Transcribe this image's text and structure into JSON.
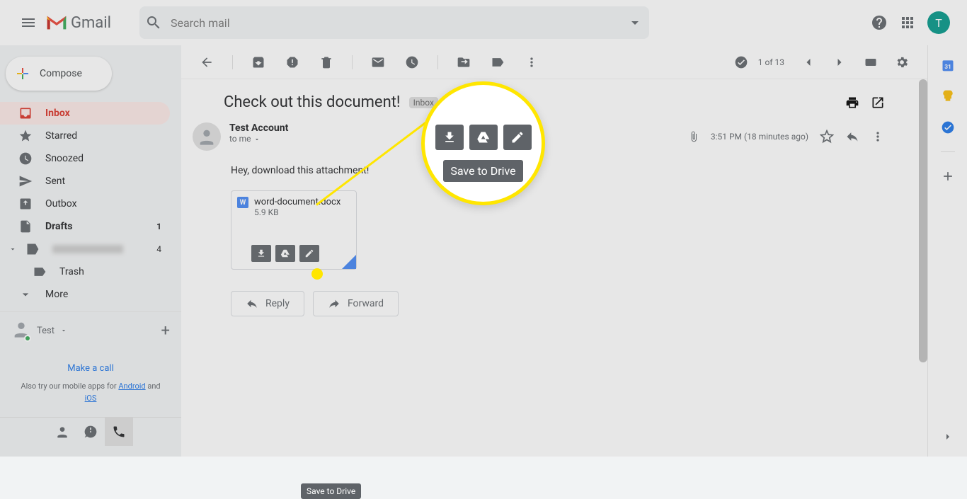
{
  "header": {
    "logo_text": "Gmail",
    "search_placeholder": "Search mail",
    "avatar_initial": "T"
  },
  "compose_label": "Compose",
  "nav": {
    "inbox": "Inbox",
    "starred": "Starred",
    "snoozed": "Snoozed",
    "sent": "Sent",
    "outbox": "Outbox",
    "drafts": "Drafts",
    "drafts_count": "1",
    "category_count": "4",
    "trash": "Trash",
    "more": "More"
  },
  "hangouts": {
    "user": "Test",
    "make_call": "Make a call",
    "mobile_prefix": "Also try our mobile apps for ",
    "android": "Android",
    "and": " and ",
    "ios": "iOS"
  },
  "toolbar": {
    "counter": "1 of 13"
  },
  "email": {
    "subject": "Check out this document!",
    "badge": "Inbox",
    "sender": "Test Account",
    "to": "to me",
    "time": "3:51 PM (18 minutes ago)",
    "body": "Hey, download this attachment!"
  },
  "attachment": {
    "name": "word-document.docx",
    "size": "5.9 KB",
    "tooltip": "Save to Drive",
    "w_label": "W"
  },
  "zoom": {
    "tooltip": "Save to Drive"
  },
  "actions": {
    "reply": "Reply",
    "forward": "Forward"
  }
}
